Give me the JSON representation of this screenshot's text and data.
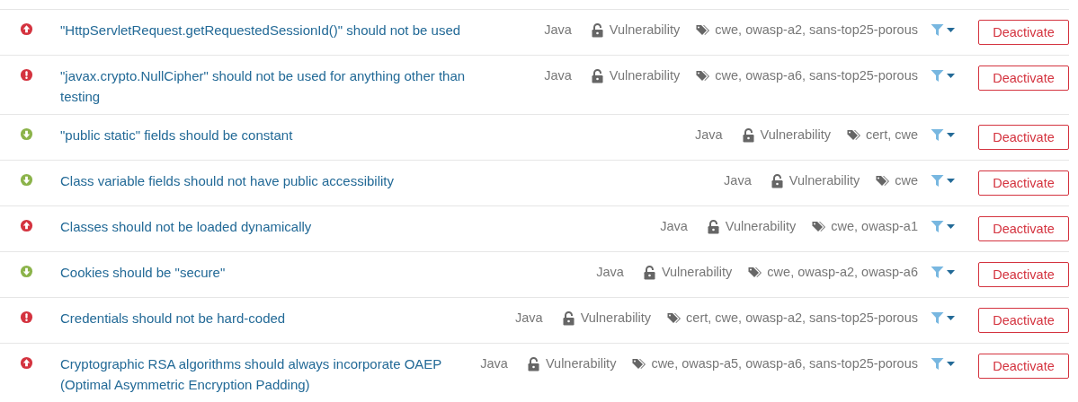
{
  "rules": [
    {
      "kind": "critical",
      "title": "\"HttpServletRequest.getRequestedSessionId()\" should not be used",
      "language": "Java",
      "type": "Vulnerability",
      "tags": "cwe, owasp-a2, sans-top25-porous",
      "action": "Deactivate"
    },
    {
      "kind": "blocker",
      "title": "\"javax.crypto.NullCipher\" should not be used for anything other than testing",
      "language": "Java",
      "type": "Vulnerability",
      "tags": "cwe, owasp-a6, sans-top25-porous",
      "action": "Deactivate"
    },
    {
      "kind": "minor",
      "title": "\"public static\" fields should be constant",
      "language": "Java",
      "type": "Vulnerability",
      "tags": "cert, cwe",
      "action": "Deactivate"
    },
    {
      "kind": "minor",
      "title": "Class variable fields should not have public accessibility",
      "language": "Java",
      "type": "Vulnerability",
      "tags": "cwe",
      "action": "Deactivate"
    },
    {
      "kind": "critical",
      "title": "Classes should not be loaded dynamically",
      "language": "Java",
      "type": "Vulnerability",
      "tags": "cwe, owasp-a1",
      "action": "Deactivate"
    },
    {
      "kind": "minor",
      "title": "Cookies should be \"secure\"",
      "language": "Java",
      "type": "Vulnerability",
      "tags": "cwe, owasp-a2, owasp-a6",
      "action": "Deactivate"
    },
    {
      "kind": "blocker",
      "title": "Credentials should not be hard-coded",
      "language": "Java",
      "type": "Vulnerability",
      "tags": "cert, cwe, owasp-a2, sans-top25-porous",
      "action": "Deactivate"
    },
    {
      "kind": "critical",
      "title": "Cryptographic RSA algorithms should always incorporate OAEP (Optimal Asymmetric Encryption Padding)",
      "language": "Java",
      "type": "Vulnerability",
      "tags": "cwe, owasp-a5, owasp-a6, sans-top25-porous",
      "action": "Deactivate"
    }
  ]
}
